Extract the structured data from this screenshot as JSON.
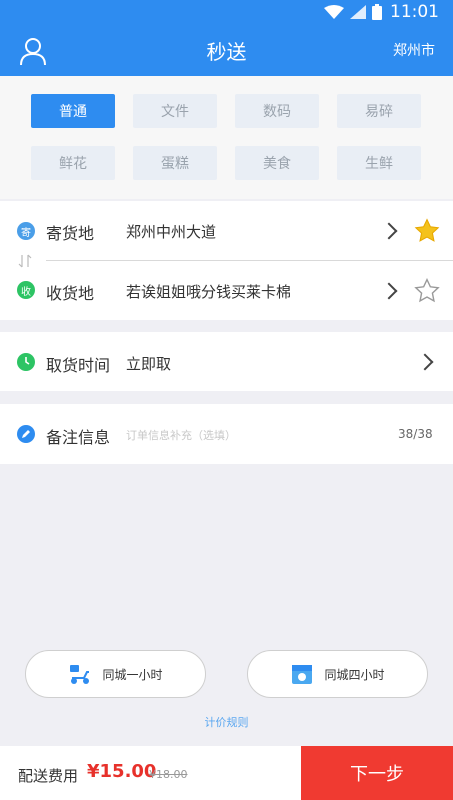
{
  "status_bar": {
    "time": "11:01"
  },
  "header": {
    "title": "秒送",
    "city": "郑州市"
  },
  "categories": [
    {
      "label": "普通",
      "active": true
    },
    {
      "label": "文件",
      "active": false
    },
    {
      "label": "数码",
      "active": false
    },
    {
      "label": "易碎",
      "active": false
    },
    {
      "label": "鲜花",
      "active": false
    },
    {
      "label": "蛋糕",
      "active": false
    },
    {
      "label": "美食",
      "active": false
    },
    {
      "label": "生鲜",
      "active": false
    }
  ],
  "sender": {
    "icon_text": "寄",
    "label": "寄货地",
    "value": "郑州中州大道",
    "favorite": true
  },
  "receiver": {
    "icon_text": "收",
    "label": "收货地",
    "value": "若诶姐姐哦分钱买莱卡棉",
    "favorite": false
  },
  "pickup": {
    "label": "取货时间",
    "value": "立即取"
  },
  "note": {
    "label": "备注信息",
    "placeholder": "订单信息补充（选填）",
    "counter": "38/38"
  },
  "delivery_options": [
    {
      "label": "同城一小时",
      "icon": "scooter-icon"
    },
    {
      "label": "同城四小时",
      "icon": "box-icon"
    }
  ],
  "pricing_rules": "计价规则",
  "footer": {
    "fee_label": "配送费用",
    "fee": "¥15.00",
    "original_fee": "¥18.00",
    "next_label": "下一步"
  },
  "colors": {
    "primary": "#2e8cf0",
    "accent_red": "#f03a31",
    "sender_icon": "#4a9ee8",
    "receiver_icon": "#2dc464",
    "pickup_icon": "#2dc464",
    "star": "#f4c21c"
  }
}
